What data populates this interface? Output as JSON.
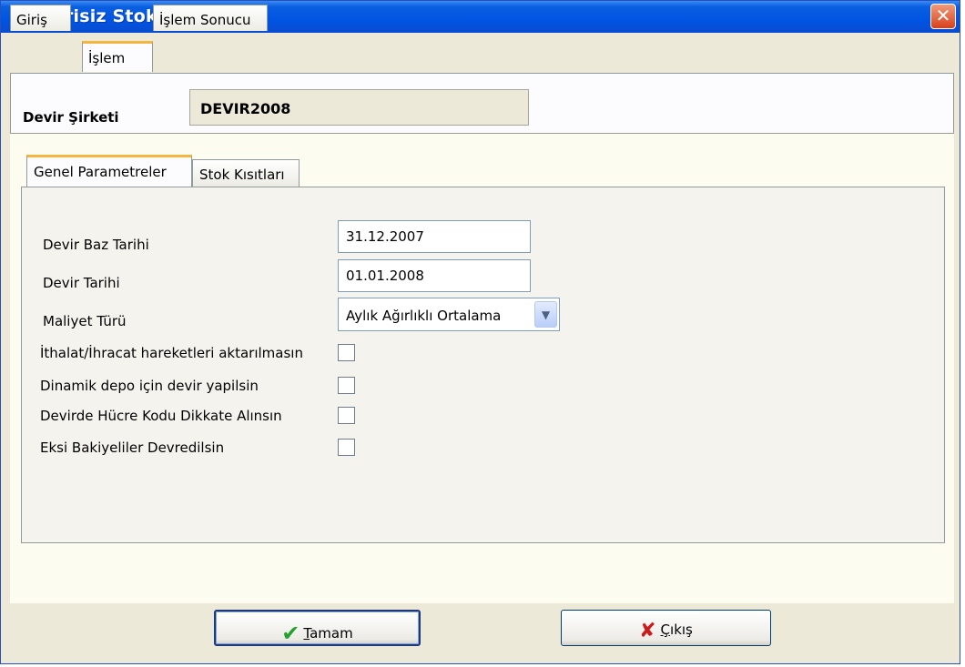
{
  "window": {
    "title": "Serisiz Stok Devri",
    "close_glyph": "✕"
  },
  "top_tabs": [
    {
      "label": "Giriş"
    },
    {
      "label": "İşlem"
    },
    {
      "label": "İşlem Sonucu"
    }
  ],
  "company": {
    "label": "Devir Şirketi",
    "value": "DEVIR2008"
  },
  "inner_tabs": [
    {
      "label": "Genel Parametreler"
    },
    {
      "label": "Stok Kısıtları"
    }
  ],
  "form": {
    "devir_baz_tarihi": {
      "label": "Devir Baz Tarihi",
      "value": "31.12.2007"
    },
    "devir_tarihi": {
      "label": "Devir Tarihi",
      "value": "01.01.2008"
    },
    "maliyet_turu": {
      "label": "Maliyet Türü",
      "value": "Aylık Ağırlıklı Ortalama"
    },
    "checkboxes": [
      {
        "label": "İthalat/İhracat hareketleri aktarılmasın",
        "checked": false
      },
      {
        "label": "Dinamik depo için devir yapilsin",
        "checked": false
      },
      {
        "label": "Devirde Hücre Kodu Dikkate Alınsın",
        "checked": false
      },
      {
        "label": "Eksi Bakiyeliler Devredilsin",
        "checked": false
      }
    ]
  },
  "buttons": {
    "ok": {
      "prefix": "",
      "mnemonic": "T",
      "rest": "amam",
      "icon": "checkmark-icon"
    },
    "exit": {
      "prefix": "",
      "mnemonic": "Ç",
      "rest": "ıkış",
      "icon": "x-icon"
    }
  }
}
